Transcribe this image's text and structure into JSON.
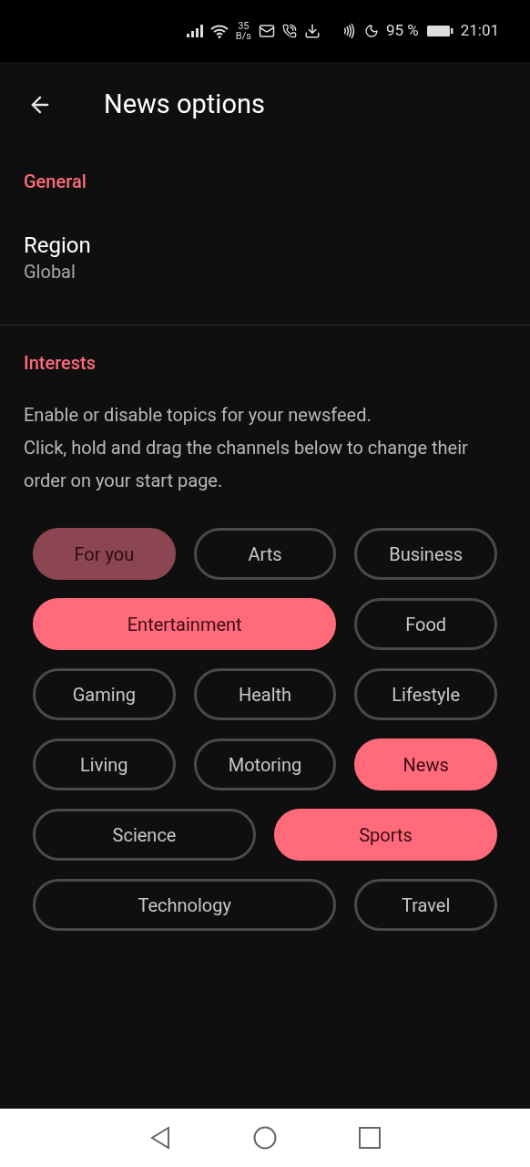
{
  "status_bar": {
    "speed_value": "35",
    "speed_unit": "B/s",
    "battery": "95 %",
    "time": "21:01"
  },
  "header": {
    "title": "News options"
  },
  "sections": [
    {
      "heading": "General",
      "setting": {
        "label": "Region",
        "value": "Global"
      }
    },
    {
      "heading": "Interests",
      "description": "Enable or disable topics for your newsfeed.\nClick, hold and drag the channels below to change their order on your start page."
    }
  ],
  "topics": [
    {
      "label": "For you",
      "selected": true,
      "disabled": true,
      "kind": "normal"
    },
    {
      "label": "Arts",
      "selected": false,
      "disabled": false,
      "kind": "normal"
    },
    {
      "label": "Business",
      "selected": false,
      "disabled": false,
      "kind": "normal"
    },
    {
      "label": "Entertainment",
      "selected": true,
      "disabled": false,
      "kind": "wide"
    },
    {
      "label": "Food",
      "selected": false,
      "disabled": false,
      "kind": "normal"
    },
    {
      "label": "Gaming",
      "selected": false,
      "disabled": false,
      "kind": "normal"
    },
    {
      "label": "Health",
      "selected": false,
      "disabled": false,
      "kind": "normal"
    },
    {
      "label": "Lifestyle",
      "selected": false,
      "disabled": false,
      "kind": "normal"
    },
    {
      "label": "Living",
      "selected": false,
      "disabled": false,
      "kind": "normal"
    },
    {
      "label": "Motoring",
      "selected": false,
      "disabled": false,
      "kind": "normal"
    },
    {
      "label": "News",
      "selected": true,
      "disabled": false,
      "kind": "normal"
    },
    {
      "label": "Science",
      "selected": false,
      "disabled": false,
      "kind": "half"
    },
    {
      "label": "Sports",
      "selected": true,
      "disabled": false,
      "kind": "half"
    },
    {
      "label": "Technology",
      "selected": false,
      "disabled": false,
      "kind": "wide"
    },
    {
      "label": "Travel",
      "selected": false,
      "disabled": false,
      "kind": "normal"
    }
  ]
}
